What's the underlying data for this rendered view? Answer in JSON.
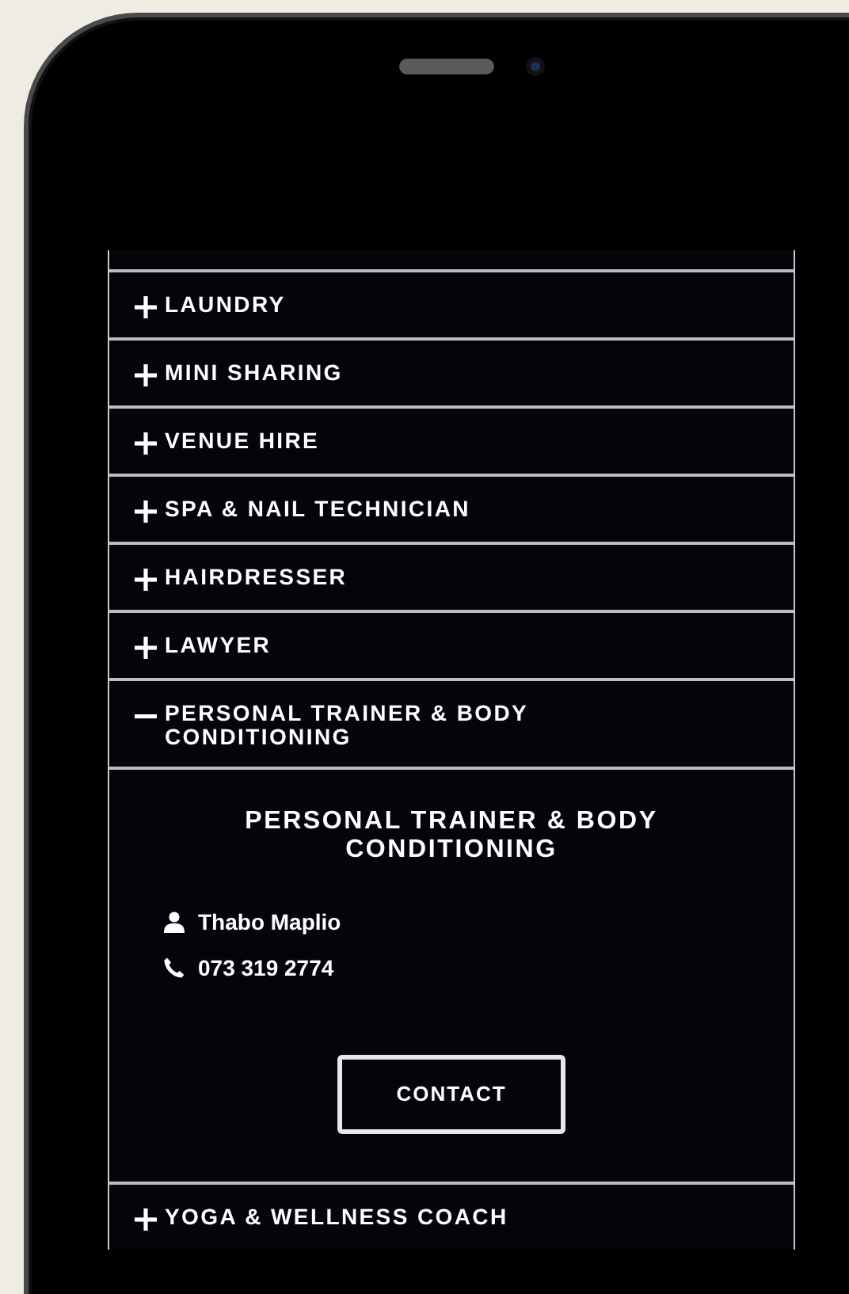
{
  "items": [
    {
      "title": "LAUNDRY",
      "expanded": false
    },
    {
      "title": "MINI SHARING",
      "expanded": false
    },
    {
      "title": "VENUE HIRE",
      "expanded": false
    },
    {
      "title": "SPA & NAIL TECHNICIAN",
      "expanded": false
    },
    {
      "title": "HAIRDRESSER",
      "expanded": false
    },
    {
      "title": "LAWYER",
      "expanded": false
    },
    {
      "title": "PERSONAL TRAINER & BODY CONDITIONING",
      "expanded": true,
      "panel": {
        "heading": "PERSONAL TRAINER & BODY CONDITIONING",
        "contact_name": "Thabo Maplio",
        "phone": "073 319 2774",
        "button": "CONTACT"
      }
    },
    {
      "title": "YOGA & WELLNESS COACH",
      "expanded": false
    }
  ]
}
